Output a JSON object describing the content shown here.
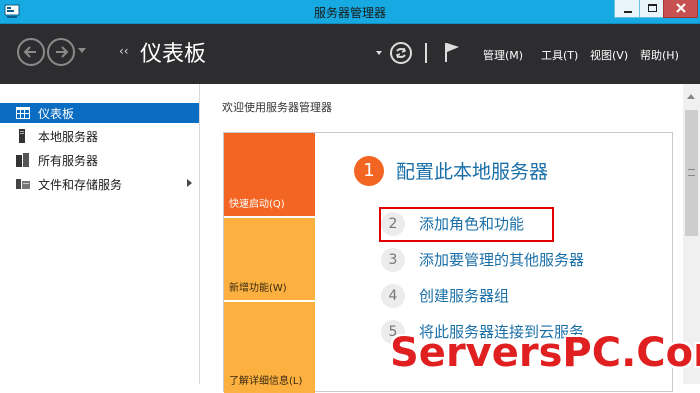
{
  "window": {
    "title": "服务器管理器"
  },
  "toolbar": {
    "breadcrumb_arrows": "‹‹",
    "title": "仪表板",
    "menus": [
      {
        "label": "管理(M)"
      },
      {
        "label": "工具(T)"
      },
      {
        "label": "视图(V)"
      },
      {
        "label": "帮助(H)"
      }
    ]
  },
  "sidebar": {
    "items": [
      {
        "label": "仪表板",
        "icon": "dashboard-icon",
        "active": true
      },
      {
        "label": "本地服务器",
        "icon": "server-icon"
      },
      {
        "label": "所有服务器",
        "icon": "servers-icon"
      },
      {
        "label": "文件和存储服务",
        "icon": "storage-icon",
        "has_submenu": true
      }
    ]
  },
  "main": {
    "welcome": "欢迎使用服务器管理器",
    "tiles": [
      {
        "label": "快速启动(Q)",
        "color": "#f26522"
      },
      {
        "label": "新增功能(W)",
        "color": "#fbb040"
      },
      {
        "label": "了解详细信息(L)",
        "color": "#fbb040"
      }
    ],
    "steps": [
      {
        "num": "1",
        "label": "配置此本地服务器"
      },
      {
        "num": "2",
        "label": "添加角色和功能"
      },
      {
        "num": "3",
        "label": "添加要管理的其他服务器"
      },
      {
        "num": "4",
        "label": "创建服务器组"
      },
      {
        "num": "5",
        "label": "将此服务器连接到云服务"
      }
    ]
  },
  "watermark": "ServersPC.Com",
  "colors": {
    "titlebar": "#17a9e1",
    "toolbar": "#2d2d30",
    "accent_orange": "#f26522",
    "accent_yellow": "#fbb040",
    "link_blue": "#1a6fa8",
    "highlight_red": "#e00000"
  }
}
